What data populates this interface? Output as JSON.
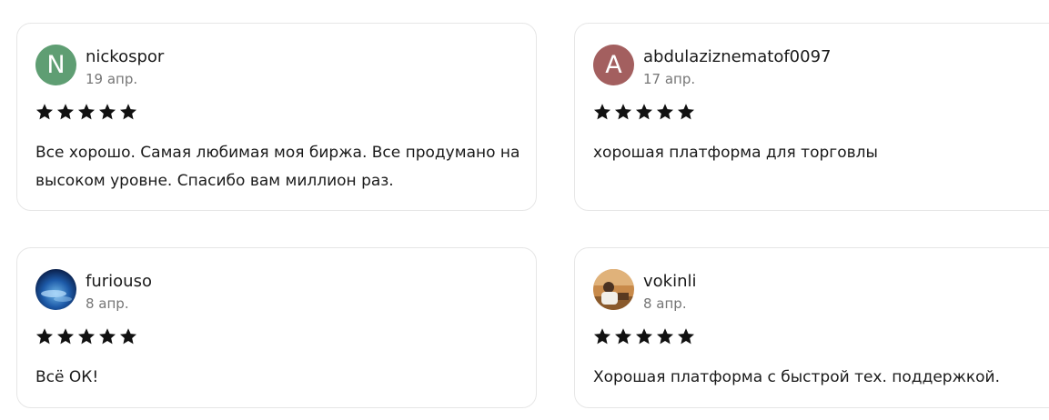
{
  "reviews": [
    {
      "author": "nickospor",
      "avatar_letter": "N",
      "avatar_color": "#5f9e73",
      "date": "19 апр.",
      "rating": 5,
      "text": "Все хорошо. Самая любимая моя биржа. Все продумано на высоком уровне. Спасибо вам миллион раз."
    },
    {
      "author": "abdulaziznematof0097",
      "avatar_letter": "A",
      "avatar_color": "#a35f5f",
      "date": "17 апр.",
      "rating": 5,
      "text": "хорошая платформа для торговлы"
    },
    {
      "author": "furiouso",
      "avatar_icon": "photo-avatar-icon",
      "date": "8 апр.",
      "rating": 5,
      "text": "Всё ОК!"
    },
    {
      "author": "vokinli",
      "avatar_icon": "photo-avatar-icon",
      "date": "8 апр.",
      "rating": 5,
      "text": "Хорошая платформа с быстрой тех. поддержкой."
    }
  ],
  "colors": {
    "star": "#111111",
    "card_border": "#e6e6e6",
    "date_text": "#767676"
  }
}
